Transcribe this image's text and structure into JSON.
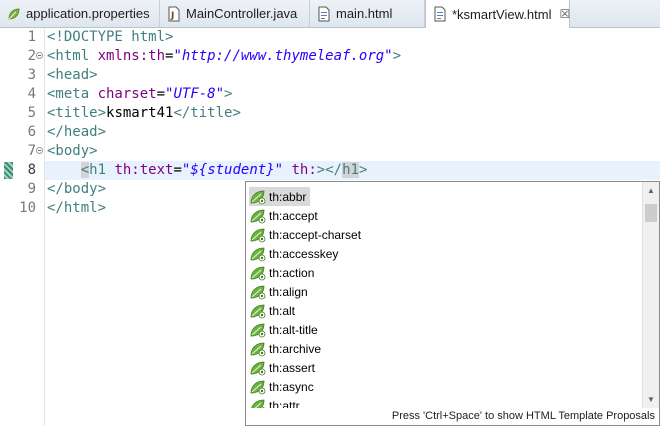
{
  "tabs": [
    {
      "label": "application.properties",
      "icon": "properties-file-icon",
      "active": false
    },
    {
      "label": "MainController.java",
      "icon": "java-file-icon",
      "active": false
    },
    {
      "label": "main.html",
      "icon": "html-file-icon",
      "active": false
    },
    {
      "label": "*ksmartView.html",
      "icon": "html-file-icon",
      "active": true,
      "close": "☒"
    }
  ],
  "code_lines": [
    {
      "num": "1",
      "fold": false
    },
    {
      "num": "2",
      "fold": true
    },
    {
      "num": "3",
      "fold": false
    },
    {
      "num": "4",
      "fold": false
    },
    {
      "num": "5",
      "fold": false
    },
    {
      "num": "6",
      "fold": false
    },
    {
      "num": "7",
      "fold": true
    },
    {
      "num": "8",
      "fold": false,
      "current": true
    },
    {
      "num": "9",
      "fold": false
    },
    {
      "num": "10",
      "fold": false
    }
  ],
  "code": {
    "l1": {
      "a": "<!DOCTYPE ",
      "b": "html",
      "c": ">"
    },
    "l2": {
      "a": "<html ",
      "b": "xmlns:th",
      "c": "=",
      "d": "\"http://www.thymeleaf.org\"",
      "e": ">"
    },
    "l3": {
      "a": "<head>"
    },
    "l4": {
      "a": "<meta ",
      "b": "charset",
      "c": "=",
      "d": "\"UTF-8\"",
      "e": ">"
    },
    "l5": {
      "a": "<title>",
      "b": "ksmart41",
      "c": "</title>"
    },
    "l6": {
      "a": "</head>"
    },
    "l7": {
      "a": "<body>"
    },
    "l8": {
      "indent": "    ",
      "a": "<",
      "b": "h1",
      "c": " ",
      "d": "th:text",
      "e": "=",
      "f": "\"${student}\"",
      "g": " ",
      "h": "th:",
      "i": "></",
      "j": "h1",
      "k": ">"
    },
    "l9": {
      "a": "</body>"
    },
    "l10": {
      "a": "</html>"
    }
  },
  "proposals": [
    "th:abbr",
    "th:accept",
    "th:accept-charset",
    "th:accesskey",
    "th:action",
    "th:align",
    "th:alt",
    "th:alt-title",
    "th:archive",
    "th:assert",
    "th:async",
    "th:attr"
  ],
  "proposal_icon": "thymeleaf-leaf-icon",
  "selected_proposal": "th:abbr",
  "status_hint": "Press 'Ctrl+Space' to show HTML Template Proposals",
  "scroll": {
    "up": "▲",
    "down": "▼"
  },
  "colors": {
    "tag": "#3f7f7f",
    "attribute": "#7f007f",
    "value": "#2a00ff",
    "current_line": "#e8f2fe"
  }
}
